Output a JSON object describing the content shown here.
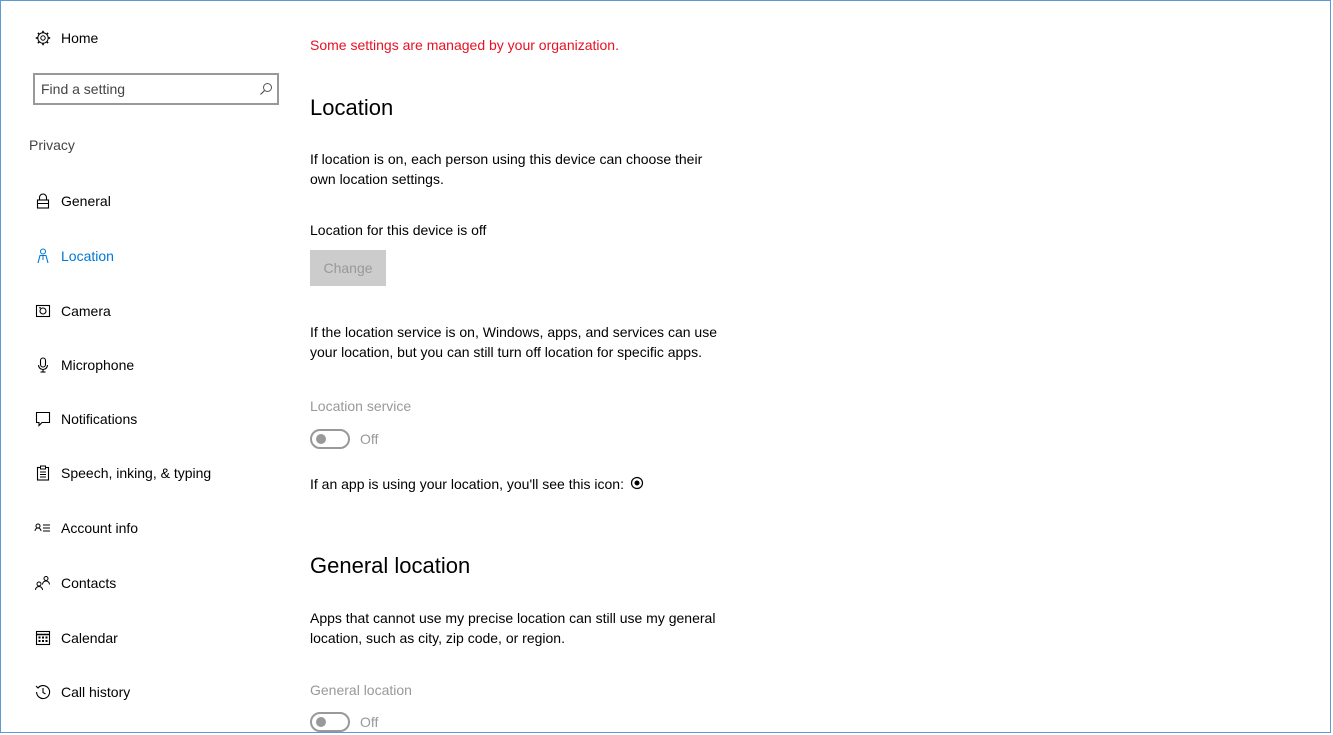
{
  "sidebar": {
    "home": {
      "label": "Home",
      "icon": "gear-icon"
    },
    "search": {
      "placeholder": "Find a setting",
      "value": ""
    },
    "group_label": "Privacy",
    "items": [
      {
        "label": "General",
        "icon": "lock-icon",
        "selected": false
      },
      {
        "label": "Location",
        "icon": "person-location-icon",
        "selected": true
      },
      {
        "label": "Camera",
        "icon": "camera-icon",
        "selected": false
      },
      {
        "label": "Microphone",
        "icon": "microphone-icon",
        "selected": false
      },
      {
        "label": "Notifications",
        "icon": "notification-icon",
        "selected": false
      },
      {
        "label": "Speech, inking, & typing",
        "icon": "clipboard-icon",
        "selected": false
      },
      {
        "label": "Account info",
        "icon": "account-info-icon",
        "selected": false
      },
      {
        "label": "Contacts",
        "icon": "contacts-icon",
        "selected": false
      },
      {
        "label": "Calendar",
        "icon": "calendar-icon",
        "selected": false
      },
      {
        "label": "Call history",
        "icon": "history-icon",
        "selected": false
      }
    ]
  },
  "main": {
    "managed_notice": "Some settings are managed by your organization.",
    "location": {
      "title": "Location",
      "desc_line1": "If location is on, each person using this device can choose their",
      "desc_line2": "own location settings.",
      "device_status": "Location for this device is off",
      "change_button": "Change",
      "service_desc_line1": "If the location service is on, Windows, apps, and services can use",
      "service_desc_line2": "your location, but you can still turn off location for specific apps.",
      "service_label": "Location service",
      "service_toggle_state": "Off",
      "icon_note": "If an app is using your location, you'll see this icon:"
    },
    "general_location": {
      "title": "General location",
      "desc_line1": "Apps that cannot use my precise location can still use my general",
      "desc_line2": "location, such as city, zip code, or region.",
      "label": "General location",
      "toggle_state": "Off"
    }
  },
  "colors": {
    "accent": "#0078d7",
    "warning": "#e81123",
    "disabled_text": "#999999",
    "window_border": "#5b9bd5"
  }
}
